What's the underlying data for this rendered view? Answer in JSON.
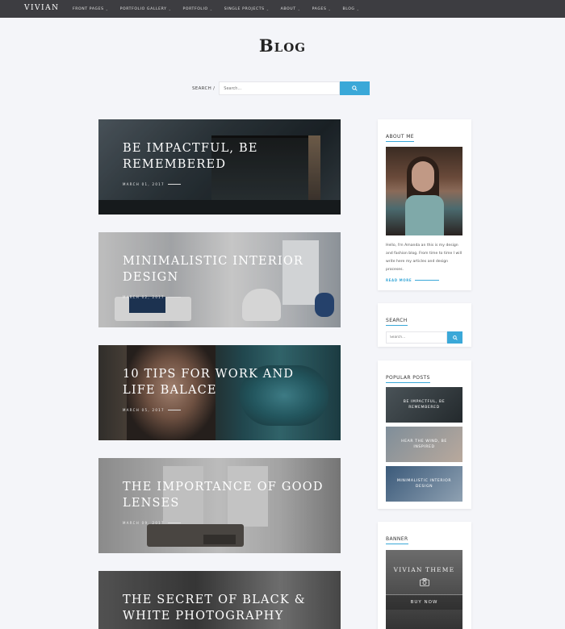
{
  "header": {
    "logo": "VIVIAN",
    "nav": [
      {
        "label": "FRONT PAGES"
      },
      {
        "label": "PORTFOLIO GALLERY"
      },
      {
        "label": "PORTFOLIO"
      },
      {
        "label": "SINGLE PROJECTS"
      },
      {
        "label": "ABOUT"
      },
      {
        "label": "PAGES"
      },
      {
        "label": "BLOG"
      }
    ]
  },
  "page": {
    "title": "Blog"
  },
  "search": {
    "label": "SEARCH /",
    "placeholder": "Search..."
  },
  "posts": [
    {
      "title": "BE IMPACTFUL, BE REMEMBERED",
      "date": "MARCH 01, 2017"
    },
    {
      "title": "MINIMALISTIC INTERIOR DESIGN",
      "date": "MARCH 02, 2017"
    },
    {
      "title": "10 TIPS FOR WORK AND LIFE BALACE",
      "date": "MARCH 05, 2017"
    },
    {
      "title": "THE IMPORTANCE OF GOOD LENSES",
      "date": "MARCH 09, 2017"
    },
    {
      "title": "THE SECRET OF BLACK & WHITE PHOTOGRAPHY",
      "date": ""
    }
  ],
  "sidebar": {
    "about": {
      "title": "ABOUT ME",
      "text": "Hello, I'm Amanda an this is my design and fashion blog. From time to time I will write here my articles and design proceses.",
      "read_more": "READ MORE"
    },
    "search": {
      "title": "SEARCH",
      "placeholder": "Search..."
    },
    "popular": {
      "title": "POPULAR POSTS",
      "items": [
        {
          "label": "BE IMPACTFUL, BE REMEMBERED"
        },
        {
          "label": "HEAR THE WIND, BE INSPIRED"
        },
        {
          "label": "MINIMALISTIC INTERIOR DESIGN"
        }
      ]
    },
    "banner": {
      "title": "BANNER",
      "heading": "VIVIAN THEME",
      "button": "BUY NOW"
    }
  },
  "colors": {
    "accent": "#3aa8d8",
    "topbar": "#3d3d41",
    "background": "#f4f5f9"
  }
}
